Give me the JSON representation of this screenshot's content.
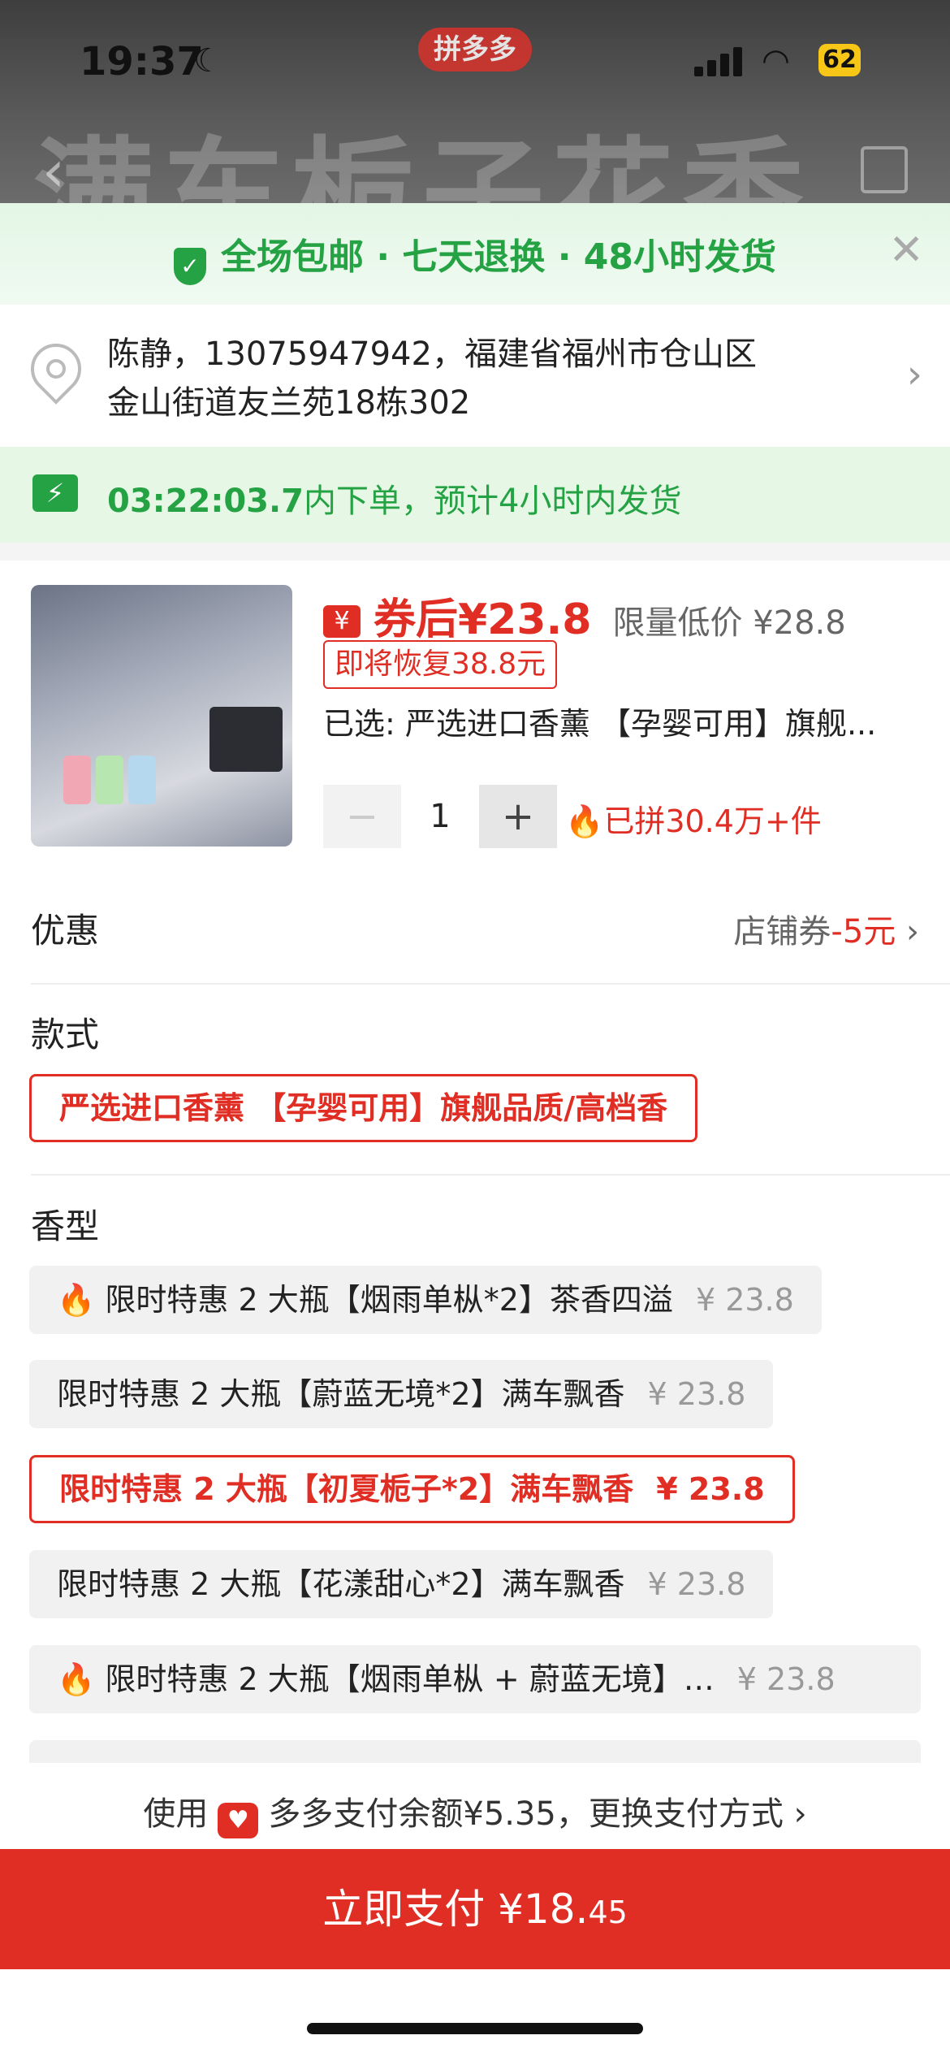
{
  "status_bar": {
    "time": "19:37",
    "app_badge": "拼多多",
    "battery": "62"
  },
  "background_title": "满车栀子花香",
  "promo": {
    "text": "全场包邮 · 七天退换 · 48小时发货",
    "color": "#25a244"
  },
  "address": {
    "line1": "陈静，13075947942，福建省福州市仓山区",
    "line2": "金山街道友兰苑18栋302"
  },
  "shipping": {
    "countdown": "03:22:03.7",
    "text": "内下单，预计4小时内发货"
  },
  "product": {
    "coupon_icon": "¥",
    "after_coupon_price": "券后¥23.8",
    "limited_price": "限量低价 ¥28.8",
    "restore_tag": "即将恢复38.8元",
    "selected": "已选: 严选进口香薰 【孕婴可用】旗舰...",
    "quantity": "1",
    "qty_minus": "−",
    "qty_plus": "+",
    "sold": "已拼30.4万+件"
  },
  "discount": {
    "label": "优惠",
    "coupon_label": "店铺券",
    "coupon_value": "-5元",
    "arrow": "›"
  },
  "style_section": {
    "label": "款式",
    "option": "严选进口香薰 【孕婴可用】旗舰品质/高档香"
  },
  "scent_section": {
    "label": "香型",
    "options": [
      {
        "label": "限时特惠 2 大瓶【烟雨单枞*2】茶香四溢",
        "price": "¥ 23.8",
        "hot": true,
        "selected": false
      },
      {
        "label": "限时特惠 2 大瓶【蔚蓝无境*2】满车飘香",
        "price": "¥ 23.8",
        "hot": false,
        "selected": false
      },
      {
        "label": "限时特惠 2 大瓶【初夏栀子*2】满车飘香",
        "price": "¥ 23.8",
        "hot": false,
        "selected": true
      },
      {
        "label": "限时特惠 2 大瓶【花漾甜心*2】满车飘香",
        "price": "¥ 23.8",
        "hot": false,
        "selected": false
      },
      {
        "label": "限时特惠 2 大瓶【烟雨单枞 + 蔚蓝无境】…",
        "price": "¥ 23.8",
        "hot": true,
        "selected": false
      }
    ]
  },
  "payment": {
    "prefix": "使用",
    "text": "多多支付余额¥5.35，更换支付方式",
    "arrow": "›"
  },
  "pay_button": {
    "label": "立即支付 ¥18.",
    "cents": "45"
  },
  "colors": {
    "accent_red": "#e02e24",
    "green": "#25a244"
  }
}
